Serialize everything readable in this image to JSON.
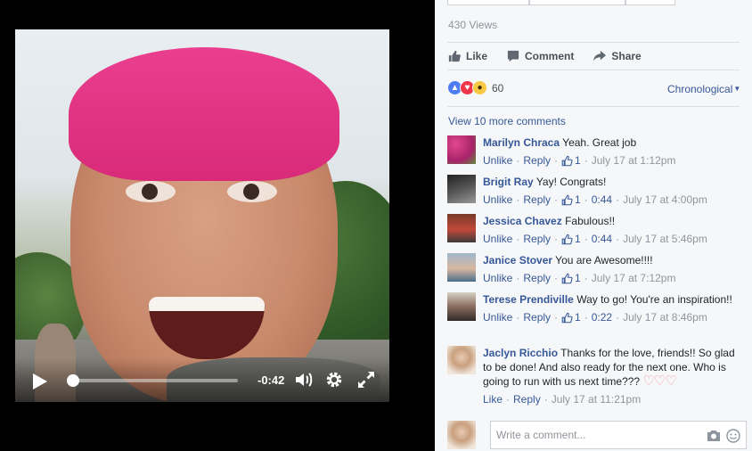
{
  "video": {
    "time_remaining": "-0:42",
    "progress": 0.0
  },
  "panel": {
    "views": "430 Views",
    "actions": {
      "like": "Like",
      "comment": "Comment",
      "share": "Share"
    },
    "reactions": {
      "count": "60",
      "types": [
        "like-icon",
        "love-icon",
        "wow-icon"
      ]
    },
    "sort_label": "Chronological",
    "view_more": "View 10 more comments",
    "comments": [
      {
        "name": "Marilyn Chraca",
        "text": "Yeah. Great job",
        "unlike": "Unlike",
        "reply": "Reply",
        "likes": "1",
        "date": "July 17 at 1:12pm"
      },
      {
        "name": "Brigit Ray",
        "text": "Yay! Congrats!",
        "unlike": "Unlike",
        "reply": "Reply",
        "likes": "1",
        "timestamp": "0:44",
        "date": "July 17 at 4:00pm"
      },
      {
        "name": "Jessica Chavez",
        "text": "Fabulous!!",
        "unlike": "Unlike",
        "reply": "Reply",
        "likes": "1",
        "timestamp": "0:44",
        "date": "July 17 at 5:46pm"
      },
      {
        "name": "Janice Stover",
        "text": "You are Awesome!!!!",
        "unlike": "Unlike",
        "reply": "Reply",
        "likes": "1",
        "date": "July 17 at 7:12pm"
      },
      {
        "name": "Terese Prendiville",
        "text": "Way to go! You're an inspiration!!",
        "unlike": "Unlike",
        "reply": "Reply",
        "likes": "1",
        "timestamp": "0:22",
        "date": "July 17 at 8:46pm"
      },
      {
        "name": "Jaclyn Ricchio",
        "text": "Thanks for the love, friends!! So glad to be done! And also ready for the next one. Who is going to run with us next time???",
        "like": "Like",
        "reply": "Reply",
        "date": "July 17 at 11:21pm"
      }
    ],
    "write_placeholder": "Write a comment..."
  },
  "colors": {
    "link": "#365899",
    "meta": "#90949c",
    "headband": "#e0327f"
  }
}
